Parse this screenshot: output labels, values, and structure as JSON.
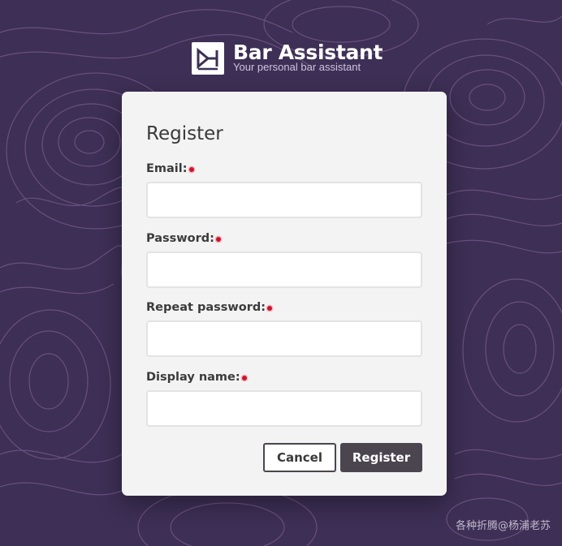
{
  "brand": {
    "title": "Bar Assistant",
    "subtitle": "Your personal bar assistant",
    "logo_icon": "bar-assistant-logo-icon"
  },
  "form": {
    "title": "Register",
    "fields": [
      {
        "label": "Email:",
        "value": "",
        "required": true
      },
      {
        "label": "Password:",
        "value": "",
        "required": true
      },
      {
        "label": "Repeat password:",
        "value": "",
        "required": true
      },
      {
        "label": "Display name:",
        "value": "",
        "required": true
      }
    ],
    "cancel_label": "Cancel",
    "register_label": "Register"
  },
  "watermark": "各种折腾@杨浦老苏",
  "colors": {
    "background": "#3d2f55",
    "contour_lines": "#7a5a8e",
    "card": "#f3f3f3",
    "primary_button": "#4a454e",
    "required_dot": "#d0122f"
  }
}
